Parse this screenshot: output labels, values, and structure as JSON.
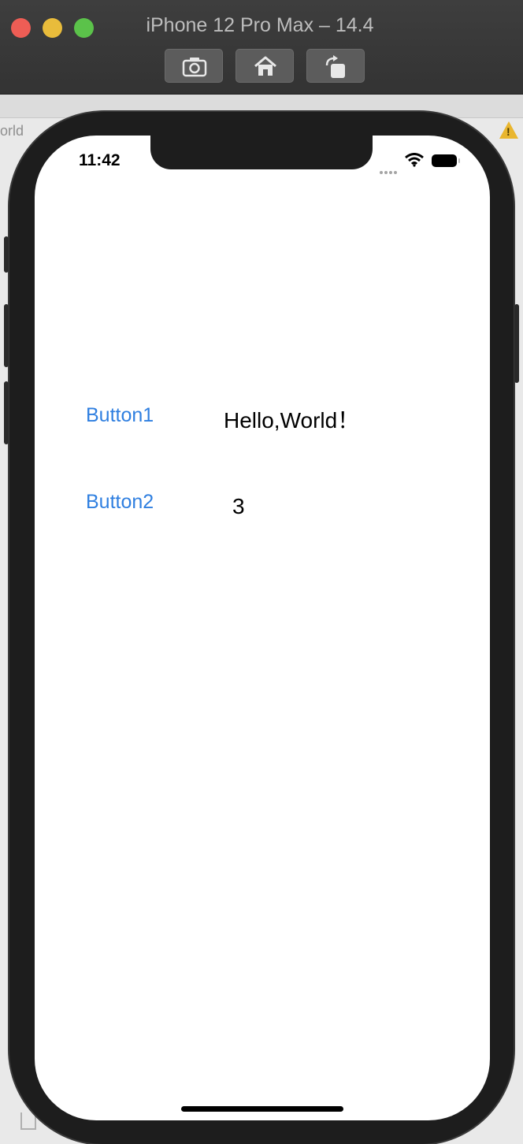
{
  "window": {
    "title": "iPhone 12 Pro Max – 14.4"
  },
  "toolbar": {
    "buttons": [
      {
        "name": "screenshot",
        "icon": "camera-icon"
      },
      {
        "name": "home",
        "icon": "home-icon"
      },
      {
        "name": "rotate",
        "icon": "rotate-icon"
      }
    ]
  },
  "background_ide": {
    "tab_fragment": "orld",
    "warning_icon": "warning-icon"
  },
  "status_bar": {
    "time": "11:42",
    "icons": [
      "signal-dots-icon",
      "wifi-icon",
      "battery-icon"
    ]
  },
  "app": {
    "button1_label": "Button1",
    "button2_label": "Button2",
    "hello_text": "Hello,World！",
    "counter_text": "3"
  },
  "colors": {
    "link_blue": "#2f7fe0",
    "titlebar": "#3a3a3a",
    "device_frame": "#1d1d1d",
    "close": "#ee5d55",
    "minimize": "#e9bc3b",
    "maximize": "#5bc24a"
  }
}
